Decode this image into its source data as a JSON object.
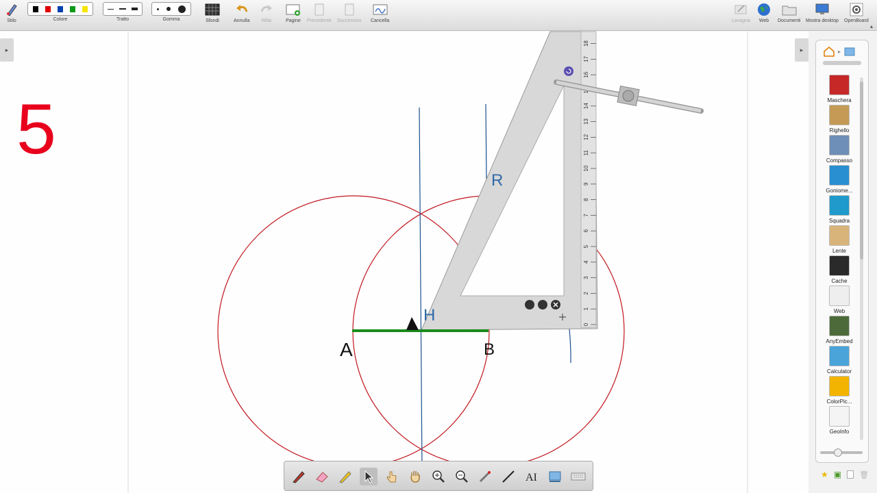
{
  "toolbar": {
    "stile": "Stilo",
    "colore": "Colore",
    "tratto": "Tratto",
    "gomma": "Gomma",
    "sfondi": "Sfondi",
    "annulla": "Annulla",
    "rifai": "Rifai",
    "pagine": "Pagine",
    "precedente": "Precedente",
    "successivo": "Successivo",
    "cancella": "Cancella",
    "lavagna": "Lavagna",
    "web": "Web",
    "documenti": "Documenti",
    "mostra_desktop": "Mostra desktop",
    "openboard": "OpenBoard"
  },
  "colors": {
    "swatches": [
      "#000000",
      "#e00000",
      "#003fb0",
      "#0a9a18",
      "#f5e400"
    ],
    "accent_red": "#e8001c",
    "circle_red": "#c0161d",
    "segment_green": "#1a8a1a",
    "line_blue": "#1b4f8c"
  },
  "page": {
    "number": "5"
  },
  "drawing": {
    "label_a": "A",
    "label_b": "B",
    "label_h": "H",
    "label_r": "R",
    "ruler_ticks": [
      "0",
      "1",
      "2",
      "3",
      "4",
      "5",
      "6",
      "7",
      "8",
      "9",
      "10",
      "11",
      "12",
      "13",
      "14",
      "15",
      "16",
      "17",
      "18"
    ]
  },
  "library": {
    "items": [
      {
        "label": "Maschera",
        "icon": "mask-icon"
      },
      {
        "label": "Righello",
        "icon": "ruler-icon"
      },
      {
        "label": "Compasso",
        "icon": "compass-icon"
      },
      {
        "label": "Goniome...",
        "icon": "protractor-icon"
      },
      {
        "label": "Squadra",
        "icon": "set-square-icon"
      },
      {
        "label": "Lente",
        "icon": "magnifier-icon"
      },
      {
        "label": "Cache",
        "icon": "cache-icon"
      },
      {
        "label": "Web",
        "icon": "folder-icon"
      },
      {
        "label": "AnyEmbed",
        "icon": "embed-icon"
      },
      {
        "label": "Calculator",
        "icon": "calculator-icon"
      },
      {
        "label": "ColorPic...",
        "icon": "color-picker-icon"
      },
      {
        "label": "GeoInfo",
        "icon": "geo-icon"
      }
    ]
  }
}
